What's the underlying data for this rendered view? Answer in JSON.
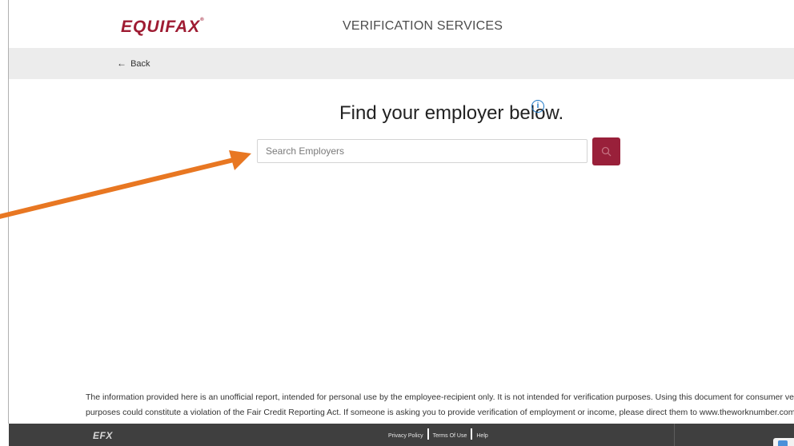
{
  "header": {
    "logo": "EQUIFAX",
    "logo_mark": "®",
    "title": "VERIFICATION SERVICES"
  },
  "nav": {
    "back_arrow": "←",
    "back_label": "Back"
  },
  "main": {
    "heading": "Find your employer below.",
    "info_glyph": "i",
    "search": {
      "placeholder": "Search Employers",
      "value": ""
    }
  },
  "disclaimer": {
    "line1": "The information provided here is an unofficial report, intended for personal use by the employee-recipient only. It is not intended for verification purposes. Using this document for consumer verification",
    "line2": "purposes could constitute a violation of the Fair Credit Reporting Act. If someone is asking you to provide verification of employment or income, please direct them to www.theworknumber.com."
  },
  "footer": {
    "logo": "EFX",
    "links": [
      "Privacy Policy",
      "Terms Of Use",
      "Help"
    ]
  },
  "icons": {
    "back": "arrow-left-icon",
    "info": "info-circle-icon",
    "search": "search-icon"
  },
  "colors": {
    "brand": "#9e1b32",
    "search_button": "#99203a",
    "info": "#1a76c6",
    "annotation_arrow": "#e87722",
    "footer_bg": "#3f3f3f",
    "subbar_bg": "#ececec"
  }
}
